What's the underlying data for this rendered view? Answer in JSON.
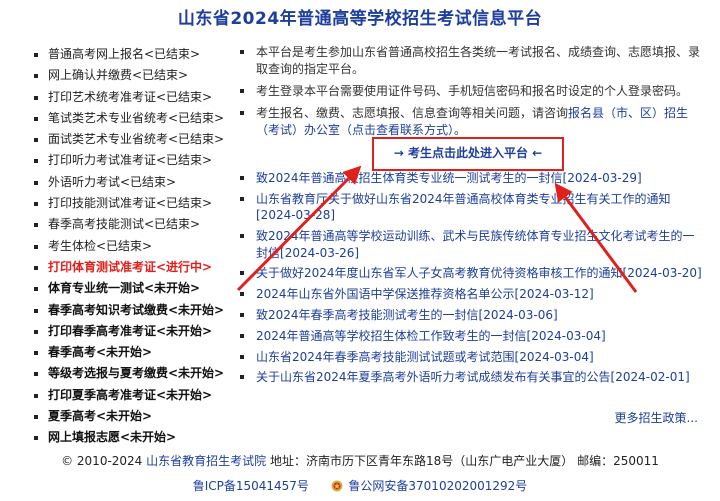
{
  "header": {
    "title": "山东省2024年普通高等学校招生考试信息平台"
  },
  "sidebar": {
    "items": [
      {
        "label": "普通高考网上报名<已结束>",
        "state": "ended"
      },
      {
        "label": "网上确认并缴费<已结束>",
        "state": "ended"
      },
      {
        "label": "打印艺术统考准考证<已结束>",
        "state": "ended"
      },
      {
        "label": "笔试类艺术专业省统考<已结束>",
        "state": "ended"
      },
      {
        "label": "面试类艺术专业省统考<已结束>",
        "state": "ended"
      },
      {
        "label": "打印听力考试准考证<已结束>",
        "state": "ended"
      },
      {
        "label": "外语听力考试<已结束>",
        "state": "ended"
      },
      {
        "label": "打印技能测试准考证<已结束>",
        "state": "ended"
      },
      {
        "label": "春季高考技能测试<已结束>",
        "state": "ended"
      },
      {
        "label": "考生体检<已结束>",
        "state": "ended"
      },
      {
        "label": "打印体育测试准考证<进行中>",
        "state": "active"
      },
      {
        "label": "体育专业统一测试<未开始>",
        "state": "pending"
      },
      {
        "label": "春季高考知识考试缴费<未开始>",
        "state": "pending"
      },
      {
        "label": "打印春季高考准考证<未开始>",
        "state": "pending"
      },
      {
        "label": "春季高考<未开始>",
        "state": "pending"
      },
      {
        "label": "等级考选报与夏考缴费<未开始>",
        "state": "pending"
      },
      {
        "label": "打印夏季高考准考证<未开始>",
        "state": "pending"
      },
      {
        "label": "夏季高考<未开始>",
        "state": "pending"
      },
      {
        "label": "网上填报志愿<未开始>",
        "state": "pending"
      }
    ]
  },
  "notices": {
    "n1": "本平台是考生参加山东省普通高校招生各类统一考试报名、成绩查询、志愿填报、录取查询的指定平台。",
    "n2": "考生登录本平台需要使用证件号码、手机短信密码和报名时设定的个人登录密码。",
    "n3_text": "考生报名、缴费、志愿填报、信息查询等相关问题，请咨询",
    "n3_link": "报名县（市、区）招生（考试）办公室（点击查看联系方式）",
    "n3_end": "。"
  },
  "enter_button": {
    "label": "→ 考生点击此处进入平台 ←"
  },
  "news": [
    {
      "title": "致2024年普通高校招生体育类专业统一测试考生的一封信",
      "date": "[2024-03-29]"
    },
    {
      "title": "山东省教育厅关于做好山东省2024年普通高校体育类专业招生有关工作的通知",
      "date": "[2024-03-28]"
    },
    {
      "title": "致2024年普通高等学校运动训练、武术与民族传统体育专业招生文化考试考生的一封信",
      "date": "[2024-03-26]"
    },
    {
      "title": "关于做好2024年度山东省军人子女高考教育优待资格审核工作的通知",
      "date": "[2024-03-20]"
    },
    {
      "title": "2024年山东省外国语中学保送推荐资格名单公示",
      "date": "[2024-03-12]"
    },
    {
      "title": "致2024年春季高考技能测试考生的一封信",
      "date": "[2024-03-06]"
    },
    {
      "title": "2024年普通高等学校招生体检工作致考生的一封信",
      "date": "[2024-03-04]"
    },
    {
      "title": "山东省2024年春季高考技能测试试题或考试范围",
      "date": "[2024-03-04]"
    },
    {
      "title": "关于山东省2024年夏季高考外语听力考试成绩发布有关事宜的公告",
      "date": "[2024-02-01]"
    }
  ],
  "more_link": "更多招生政策...",
  "footer": {
    "copyright": "© 2010-2024",
    "org": "山东省教育招生考试院",
    "address": "地址：济南市历下区青年东路18号（山东广电产业大厦）  邮编：250011",
    "icp": "鲁ICP备15041457号",
    "police": "鲁公网安备37010202001292号"
  },
  "colors": {
    "accent_blue": "#1d3f9b",
    "highlight_red": "#e0201c"
  }
}
